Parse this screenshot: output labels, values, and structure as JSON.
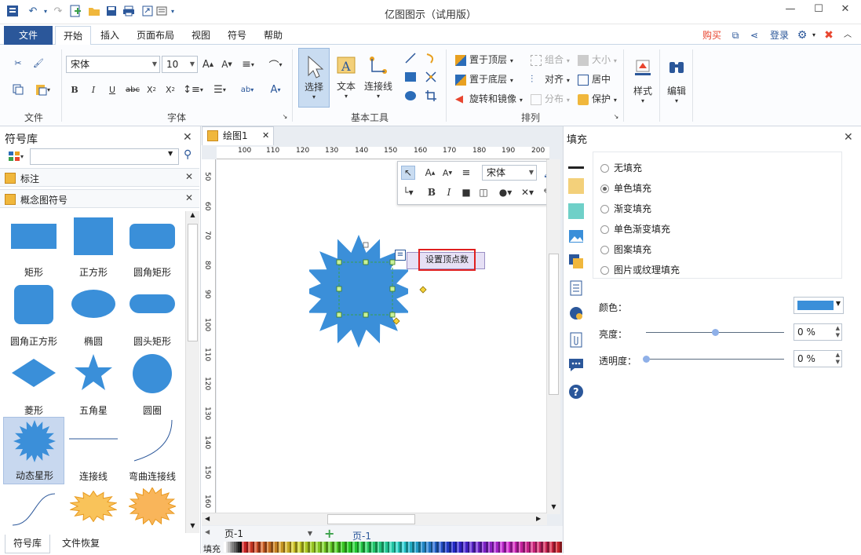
{
  "app": {
    "title": "亿图图示（试用版）"
  },
  "menu": {
    "file": "文件",
    "tabs": [
      "开始",
      "插入",
      "页面布局",
      "视图",
      "符号",
      "帮助"
    ],
    "active": "开始",
    "right": {
      "buy": "购买",
      "login": "登录"
    }
  },
  "ribbon": {
    "groups": {
      "file": "文件",
      "font": "字体",
      "basic_tools": "基本工具",
      "arrange": "排列"
    },
    "font_name": "宋体",
    "font_size": "10",
    "tools": {
      "select": "选择",
      "text": "文本",
      "connector": "连接线"
    },
    "arrange": {
      "bring_front": "置于顶层",
      "send_back": "置于底层",
      "rotate_mirror": "旋转和镜像",
      "group": "组合",
      "align": "对齐",
      "distribute": "分布",
      "size": "大小",
      "center": "居中",
      "protect": "保护"
    },
    "style": "样式",
    "edit": "编辑"
  },
  "left_panel": {
    "title": "符号库",
    "search_placeholder": "",
    "sections": [
      "标注",
      "概念图符号"
    ],
    "shapes": [
      "矩形",
      "正方形",
      "圆角矩形",
      "圆角正方形",
      "椭圆",
      "圆头矩形",
      "菱形",
      "五角星",
      "圆圈",
      "动态星形",
      "连接线",
      "弯曲连接线"
    ],
    "bottom_tabs": [
      "符号库",
      "文件恢复"
    ]
  },
  "canvas": {
    "doc_tab": "绘图1",
    "ruler_h": [
      "100",
      "110",
      "120",
      "130",
      "140",
      "150",
      "160",
      "170",
      "180",
      "190",
      "200"
    ],
    "ruler_v": [
      "50",
      "60",
      "70",
      "80",
      "90",
      "100",
      "110",
      "120",
      "130",
      "140",
      "150",
      "160"
    ],
    "float_font": "宋体",
    "tooltip": "设置顶点数",
    "page_select": "页-1",
    "page_tab": "页-1",
    "fill_label": "填充"
  },
  "right_panel": {
    "strip_title": "填充",
    "options": [
      "无填充",
      "单色填充",
      "渐变填充",
      "单色渐变填充",
      "图案填充",
      "图片或纹理填充"
    ],
    "selected": "单色填充",
    "color_label": "颜色：",
    "color_value": "#3a8fd9",
    "brightness_label": "亮度：",
    "brightness_value": "0 %",
    "brightness_level": 0.5,
    "transparency_label": "透明度：",
    "transparency_value": "0 %",
    "transparency_level": 0.0
  },
  "colors": {
    "shape": "#3b8fd9",
    "brand": "#2b579a",
    "accent": "#e8452f"
  }
}
